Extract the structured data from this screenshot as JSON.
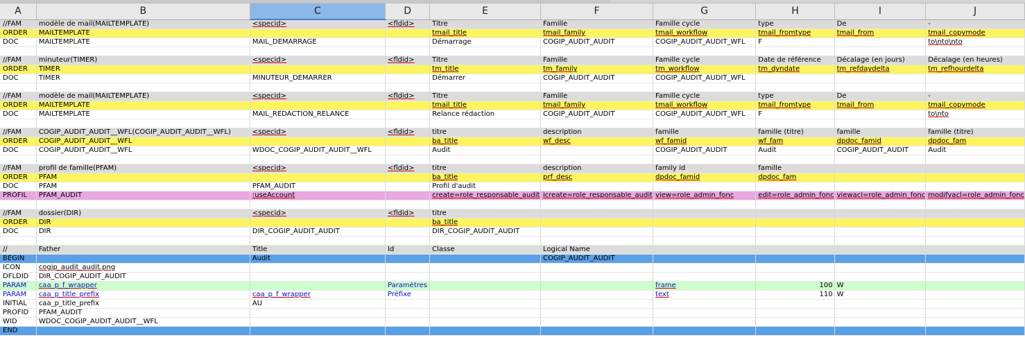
{
  "columns": [
    "A",
    "B",
    "C",
    "D",
    "E",
    "F",
    "G",
    "H",
    "I",
    "J"
  ],
  "selected_column": "C",
  "rows": [
    {
      "style": "fam",
      "cells": [
        "//FAM",
        "modèle de mail(MAILTEMPLATE)",
        "<specid>",
        "<fldid>",
        "Titre",
        "Famille",
        "Famille cycle",
        "type",
        "De",
        "-"
      ]
    },
    {
      "style": "order",
      "cells": [
        "ORDER",
        "MAILTEMPLATE",
        "",
        "",
        "tmail_title",
        "tmail_family",
        "tmail_workflow",
        "tmail_fromtype",
        "tmail_from",
        "tmail_copymode"
      ]
    },
    {
      "style": "plain",
      "cells": [
        "DOC",
        "MAILTEMPLATE",
        "MAIL_DEMARRAGE",
        "",
        "Démarrage",
        "COGIP_AUDIT_AUDIT",
        "COGIP_AUDIT_AUDIT_WFL",
        "F",
        "",
        "to\\nto\\nto"
      ]
    },
    {
      "style": "plain",
      "cells": [
        "",
        "",
        "",
        "",
        "",
        "",
        "",
        "",
        "",
        ""
      ]
    },
    {
      "style": "fam",
      "cells": [
        "//FAM",
        "minuteur(TIMER)",
        "<specid>",
        "<fldid>",
        "Titre",
        "Famille",
        "Famille cycle",
        "Date de référence",
        "Décalage (en jours)",
        "Décalage (en heures)"
      ]
    },
    {
      "style": "order",
      "cells": [
        "ORDER",
        "TIMER",
        "",
        "",
        "tm_title",
        "tm_family",
        "tm_workflow",
        "tm_dyndate",
        "tm_refdaydelta",
        "tm_refhourdelta"
      ]
    },
    {
      "style": "plain",
      "cells": [
        "DOC",
        "TIMER",
        "MINUTEUR_DEMARRER",
        "",
        "Démarrer",
        "COGIP_AUDIT_AUDIT",
        "COGIP_AUDIT_AUDIT_WFL",
        "",
        "",
        ""
      ]
    },
    {
      "style": "plain",
      "cells": [
        "",
        "",
        "",
        "",
        "",
        "",
        "",
        "",
        "",
        ""
      ]
    },
    {
      "style": "fam",
      "cells": [
        "//FAM",
        "modèle de mail(MAILTEMPLATE)",
        "<specid>",
        "<fldid>",
        "Titre",
        "Famille",
        "Famille cycle",
        "type",
        "De",
        "-"
      ]
    },
    {
      "style": "order",
      "cells": [
        "ORDER",
        "MAILTEMPLATE",
        "",
        "",
        "tmail_title",
        "tmail_family",
        "tmail_workflow",
        "tmail_fromtype",
        "tmail_from",
        "tmail_copymode"
      ]
    },
    {
      "style": "plain",
      "cells": [
        "DOC",
        "MAILTEMPLATE",
        "MAIL_REDACTION_RELANCE",
        "",
        "Relance rédaction",
        "COGIP_AUDIT_AUDIT",
        "COGIP_AUDIT_AUDIT_WFL",
        "F",
        "",
        "to\\nto"
      ]
    },
    {
      "style": "plain",
      "cells": [
        "",
        "",
        "",
        "",
        "",
        "",
        "",
        "",
        "",
        ""
      ]
    },
    {
      "style": "fam",
      "cells": [
        "//FAM",
        "COGIP_AUDIT_AUDIT__WFL(COGIP_AUDIT_AUDIT__WFL)",
        "<specid>",
        "<fldid>",
        "titre",
        "description",
        "famille",
        "famille (titre)",
        "famille",
        "famille (titre)"
      ]
    },
    {
      "style": "order",
      "cells": [
        "ORDER",
        "COGIP_AUDIT_AUDIT__WFL",
        "",
        "",
        "ba_title",
        "wf_desc",
        "wf_famid",
        "wf_fam",
        "dpdoc_famid",
        "dpdoc_fam"
      ]
    },
    {
      "style": "plain",
      "cells": [
        "DOC",
        "COGIP_AUDIT_AUDIT__WFL",
        "WDOC_COGIP_AUDIT_AUDIT__WFL",
        "",
        "Audit",
        "",
        "COGIP_AUDIT_AUDIT",
        "Audit",
        "COGIP_AUDIT_AUDIT",
        "Audit"
      ]
    },
    {
      "style": "plain",
      "cells": [
        "",
        "",
        "",
        "",
        "",
        "",
        "",
        "",
        "",
        ""
      ]
    },
    {
      "style": "fam",
      "cells": [
        "//FAM",
        "profil de famille(PFAM)",
        "<specid>",
        "<fldid>",
        "titre",
        "description",
        "family id",
        "famille",
        "",
        ""
      ]
    },
    {
      "style": "order",
      "cells": [
        "ORDER",
        "PFAM",
        "",
        "",
        "ba_title",
        "prf_desc",
        "dpdoc_famid",
        "dpdoc_fam",
        "",
        ""
      ]
    },
    {
      "style": "plain",
      "cells": [
        "DOC",
        "PFAM",
        "PFAM_AUDIT",
        "",
        "Profil d'audit",
        "",
        "",
        "",
        "",
        ""
      ]
    },
    {
      "style": "profil",
      "cells": [
        "PROFIL",
        "PFAM_AUDIT",
        ":useAccount",
        "",
        "create=role_responsable_audit",
        "icreate=role_responsable_audit",
        "view=role_admin_fonc",
        "edit=role_admin_fonc",
        "viewacl=role_admin_fonc",
        "modifyacl=role_admin_fonc"
      ]
    },
    {
      "style": "plain",
      "cells": [
        "",
        "",
        "",
        "",
        "",
        "",
        "",
        "",
        "",
        ""
      ]
    },
    {
      "style": "fam",
      "cells": [
        "//FAM",
        "dossier(DIR)",
        "<specid>",
        "<fldid>",
        "titre",
        "",
        "",
        "",
        "",
        ""
      ]
    },
    {
      "style": "order",
      "cells": [
        "ORDER",
        "DIR",
        "",
        "",
        "ba_title",
        "",
        "",
        "",
        "",
        ""
      ]
    },
    {
      "style": "plain",
      "cells": [
        "DOC",
        "DIR",
        "DIR_COGIP_AUDIT_AUDIT",
        "",
        "DIR_COGIP_AUDIT_AUDIT",
        "",
        "",
        "",
        "",
        ""
      ]
    },
    {
      "style": "plain",
      "cells": [
        "",
        "",
        "",
        "",
        "",
        "",
        "",
        "",
        "",
        ""
      ]
    },
    {
      "style": "fam",
      "cells": [
        "//",
        "Father",
        "Title",
        "Id",
        "Classe",
        "Logical Name",
        "",
        "",
        "",
        ""
      ]
    },
    {
      "style": "blue",
      "cells": [
        "BEGIN",
        "",
        "Audit",
        "",
        "",
        "COGIP_AUDIT_AUDIT",
        "",
        "",
        "",
        ""
      ]
    },
    {
      "style": "plain",
      "cells": [
        "ICON",
        "cogip_audit_audit.png",
        "",
        "",
        "",
        "",
        "",
        "",
        "",
        ""
      ]
    },
    {
      "style": "plain",
      "cells": [
        "DFLDID",
        "DIR_COGIP_AUDIT_AUDIT",
        "",
        "",
        "",
        "",
        "",
        "",
        "",
        ""
      ]
    },
    {
      "style": "param",
      "cells": [
        "PARAM",
        "caa_p_f_wrapper",
        "",
        "Paramètres",
        "",
        "",
        "frame",
        "100",
        "W",
        ""
      ]
    },
    {
      "style": "paramw",
      "cells": [
        "PARAM",
        "caa_p_title_prefix",
        "caa_p_f_wrapper",
        "Préfixe",
        "",
        "",
        "text",
        "110",
        "W",
        ""
      ]
    },
    {
      "style": "plain",
      "cells": [
        "INITIAL",
        "caa_p_title_prefix",
        "AU",
        "",
        "",
        "",
        "",
        "",
        "",
        ""
      ]
    },
    {
      "style": "plain",
      "cells": [
        "PROFID",
        "PFAM_AUDIT",
        "",
        "",
        "",
        "",
        "",
        "",
        "",
        ""
      ]
    },
    {
      "style": "plain",
      "cells": [
        "WID",
        "WDOC_COGIP_AUDIT_AUDIT__WFL",
        "",
        "",
        "",
        "",
        "",
        "",
        "",
        ""
      ]
    },
    {
      "style": "blue",
      "cells": [
        "END",
        "",
        "",
        "",
        "",
        "",
        "",
        "",
        "",
        ""
      ]
    }
  ]
}
